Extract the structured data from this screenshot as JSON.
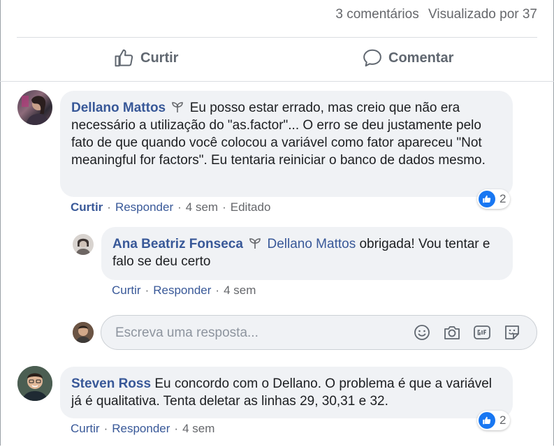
{
  "stats": {
    "comments": "3 comentários",
    "views": "Visualizado por 37"
  },
  "actions": {
    "like_label": "Curtir",
    "comment_label": "Comentar"
  },
  "comments": [
    {
      "author": "Dellano Mattos",
      "text": "Eu posso estar errado, mas creio que não era necessário a utilização do \"as.factor\"... O erro se deu justamente pelo fato de que quando você colocou a variável como fator apareceu \"Not meaningful for factors\". Eu tentaria reiniciar o banco de dados mesmo.",
      "like_action": "Curtir",
      "reply_action": "Responder",
      "time": "4 sem",
      "edited": "Editado",
      "reactions": "2"
    },
    {
      "author": "Ana Beatriz Fonseca",
      "mention": "Dellano Mattos",
      "text": "obrigada! Vou tentar e falo se deu certo",
      "like_action": "Curtir",
      "reply_action": "Responder",
      "time": "4 sem"
    },
    {
      "author": "Steven Ross",
      "text": "Eu concordo com o Dellano. O problema é que a variável já é qualitativa. Tenta deletar as linhas 29, 30,31 e 32.",
      "like_action": "Curtir",
      "reply_action": "Responder",
      "time": "4 sem",
      "reactions": "2"
    }
  ],
  "reply": {
    "placeholder": "Escreva uma resposta...",
    "icons": [
      "emoji-icon",
      "camera-icon",
      "gif-icon",
      "sticker-icon"
    ]
  },
  "colors": {
    "link": "#385898",
    "bubble": "#f0f2f5",
    "like_blue": "#1877f2",
    "muted": "#65676b"
  }
}
